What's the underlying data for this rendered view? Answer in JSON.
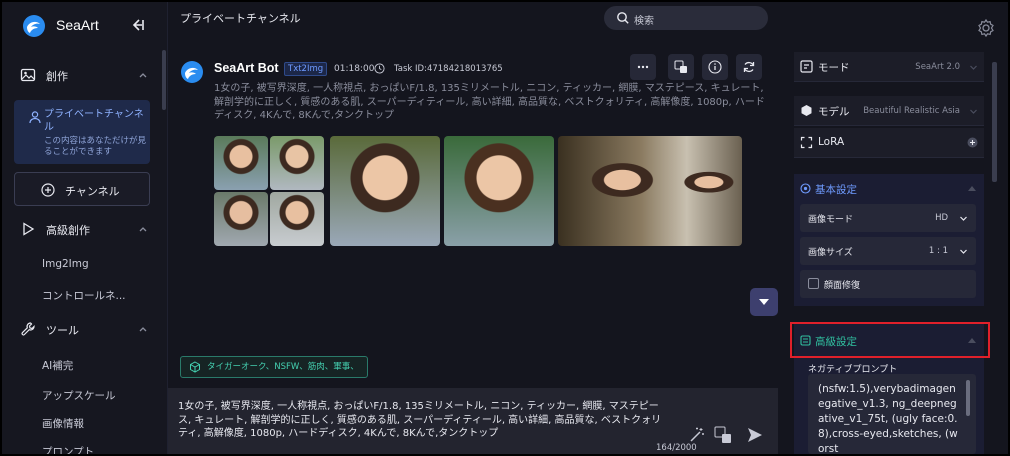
{
  "colors": {
    "accent": "#6f9bff",
    "teal": "#30c0a0",
    "highlight": "#e0202a",
    "bg": "#14151e"
  },
  "brand": {
    "name": "SeaArt"
  },
  "sidebar": {
    "sections": [
      {
        "label": "創作",
        "icon": "image-icon"
      },
      {
        "label": "高級創作",
        "icon": "play-icon"
      },
      {
        "label": "ツール",
        "icon": "wrench-icon"
      }
    ],
    "private_channel": {
      "title": "プライベートチャンネル",
      "subtitle": "この内容はあなただけが見ることができます"
    },
    "channel_button": "チャンネル",
    "advanced_items": [
      "Img2Img",
      "コントロールネ..."
    ],
    "tool_items": [
      "AI補完",
      "アップスケール",
      "画像情報",
      "プロンプト"
    ]
  },
  "header": {
    "title": "プライベートチャンネル",
    "search_placeholder": "検索"
  },
  "message": {
    "bot_name": "SeaArt Bot",
    "tag": "Txt2Img",
    "time": "01:18:00",
    "task_id": "Task ID:47184218013765",
    "prompt": "1女の子, 被写界深度, 一人称視点, おっぱいF/1.8, 135ミリメートル, ニコン, ティッカー, 網膜, マステピース, キュレート, 解剖学的に正しく, 質感のある肌, スーパーディティール, 高い詳細, 高品質な, ベストクォリティ, 高解像度, 1080p, ハードディスク, 4Kんで, 8Kんで,タンクトップ"
  },
  "suggestion": "タイガーオーク、NSFW、筋肉、軍事、",
  "composer": {
    "text": "1女の子, 被写界深度, 一人称視点, おっぱいF/1.8, 135ミリメートル, ニコン, ティッカー, 網膜, マステピース, キュレート, 解剖学的に正しく, 質感のある肌, スーパーディティール, 高い詳細, 高品質な, ベストクォリティ, 高解像度, 1080p, ハードディスク, 4Kんで, 8Kんで,タンクトップ",
    "counter": "164/2000"
  },
  "right": {
    "mode": {
      "label": "モード",
      "value": "SeaArt 2.0"
    },
    "model": {
      "label": "モデル",
      "value": "Beautiful Realistic Asia"
    },
    "lora": {
      "label": "LoRA"
    },
    "basic": {
      "title": "基本設定",
      "image_mode": {
        "label": "画像モード",
        "value": "HD"
      },
      "image_size": {
        "label": "画像サイズ",
        "value": "1 : 1"
      },
      "face_fix": {
        "label": "顔面修復"
      }
    },
    "advanced": {
      "title": "高級設定",
      "negative_label": "ネガティブプロンプト",
      "negative_text": "(nsfw:1.5),verybadimagenegative_v1.3, ng_deepnegative_v1_75t, (ugly face:0.8),cross-eyed,sketches, (worst"
    }
  }
}
